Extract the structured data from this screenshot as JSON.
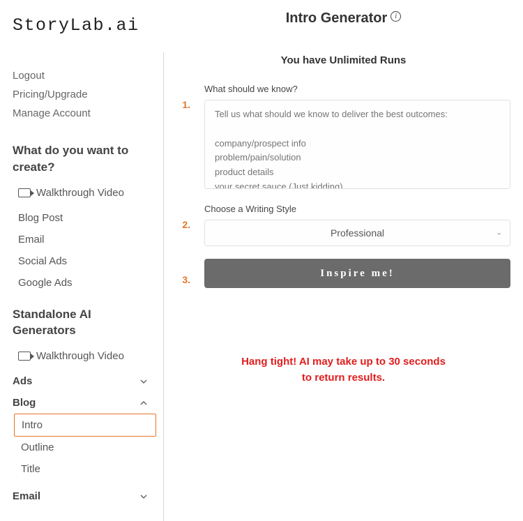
{
  "brand": "StoryLab.ai",
  "account_links": {
    "logout": "Logout",
    "pricing": "Pricing/Upgrade",
    "manage": "Manage Account"
  },
  "create_section": {
    "title": "What do you want to create?",
    "walkthrough": "Walkthrough Video",
    "items": [
      "Blog Post",
      "Email",
      "Social Ads",
      "Google Ads"
    ]
  },
  "standalone_section": {
    "title": "Standalone AI Generators",
    "walkthrough": "Walkthrough Video",
    "groups": {
      "ads": "Ads",
      "blog": "Blog",
      "email": "Email"
    },
    "blog_items": [
      "Intro",
      "Outline",
      "Title"
    ]
  },
  "main": {
    "title": "Intro Generator",
    "runs": "You have Unlimited Runs",
    "steps": {
      "one": "1.",
      "two": "2.",
      "three": "3."
    },
    "field1_label": "What should we know?",
    "field1_placeholder": "Tell us what should we know to deliver the best outcomes:\n\ncompany/prospect info\nproblem/pain/solution\nproduct details\nyour secret sauce (Just kidding)",
    "field2_label": "Choose a Writing Style",
    "field2_value": "Professional",
    "button": "Inspire me!",
    "status": "Hang tight! AI may take up to 30 seconds\nto return results."
  }
}
